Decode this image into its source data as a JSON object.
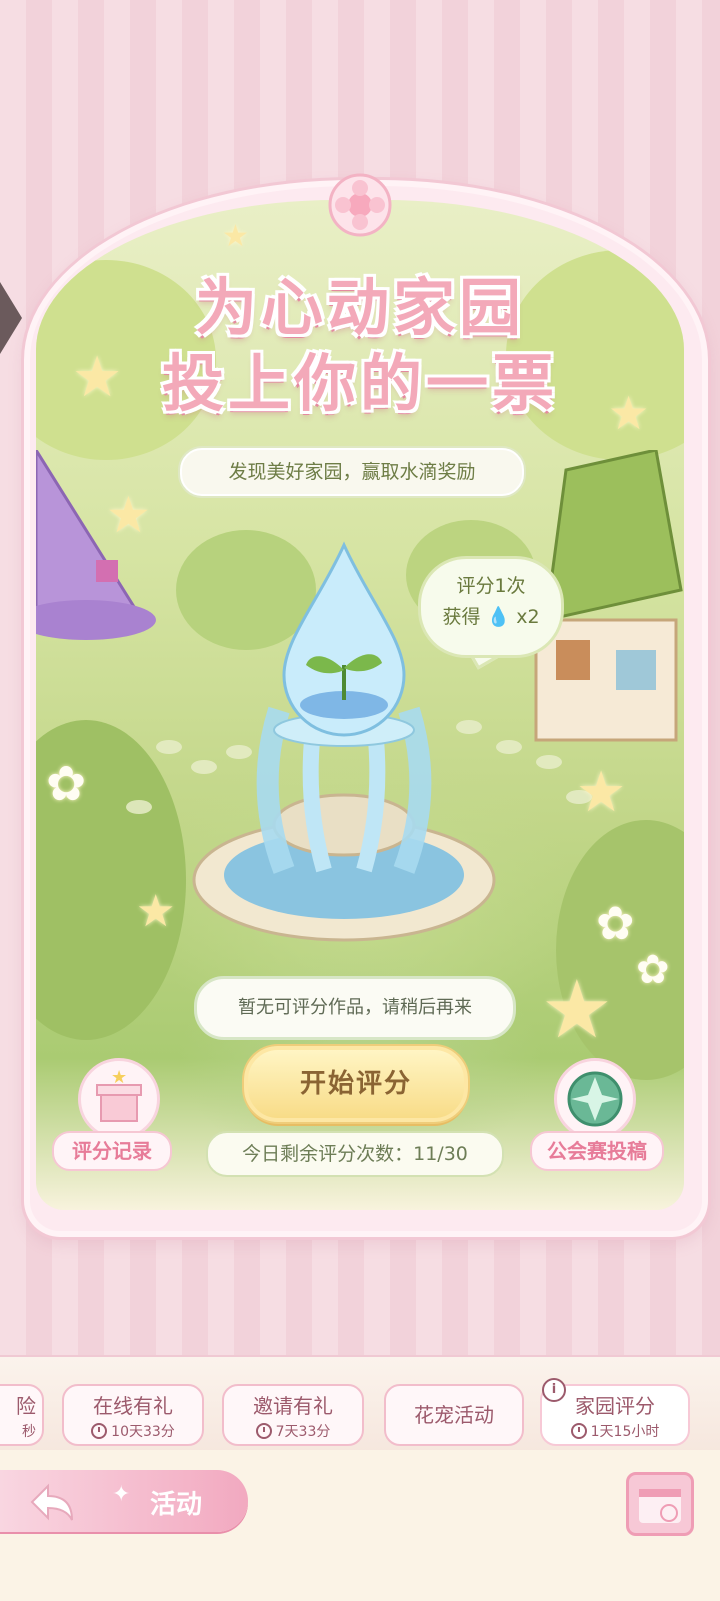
{
  "banner": {
    "title_line1": "为心动家园",
    "title_line2": "投上你的一票",
    "subtitle": "发现美好家园，赢取水滴奖励"
  },
  "reward_bubble": {
    "line1": "评分1次",
    "line2_prefix": "获得",
    "line2_suffix": "x2"
  },
  "notice": "暂无可评分作品，请稍后再来",
  "start_button": "开始评分",
  "remaining": "今日剩余评分次数：11/30",
  "left_button": "评分记录",
  "right_button": "公会赛投稿",
  "tabs": [
    {
      "title": "险",
      "sub": "秒"
    },
    {
      "title": "在线有礼",
      "sub": "10天33分"
    },
    {
      "title": "邀请有礼",
      "sub": "7天33分"
    },
    {
      "title": "花宠活动",
      "sub": ""
    },
    {
      "title": "家园评分",
      "sub": "1天15小时"
    }
  ],
  "bottom": {
    "activity_label": "活动"
  },
  "colors": {
    "accent_pink": "#f3a9b9",
    "button_yellow": "#f8dc88",
    "grass_green": "#aacb72"
  }
}
